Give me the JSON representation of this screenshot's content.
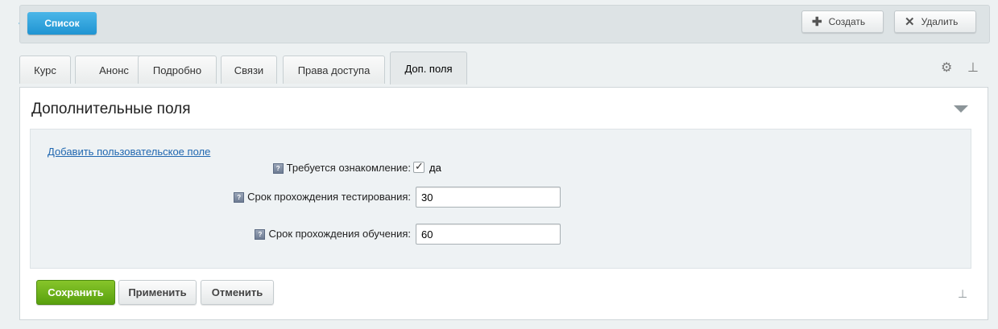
{
  "header": {
    "list_button": "Список",
    "create_button": "Создать",
    "delete_button": "Удалить"
  },
  "tabs": [
    {
      "label": "Курс"
    },
    {
      "label": "Анонс"
    },
    {
      "label": "Подробно"
    },
    {
      "label": "Связи"
    },
    {
      "label": "Права доступа"
    },
    {
      "label": "Доп. поля",
      "active": true
    }
  ],
  "panel": {
    "title": "Дополнительные поля",
    "add_field_link": "Добавить пользовательское поле",
    "fields": {
      "familiarization": {
        "label": "Требуется ознакомление:",
        "checked": true,
        "value_label": "да"
      },
      "test_period": {
        "label": "Срок прохождения тестирования:",
        "value": "30"
      },
      "study_period": {
        "label": "Срок прохождения обучения:",
        "value": "60"
      }
    },
    "help_glyph": "?"
  },
  "footer": {
    "save_button": "Сохранить",
    "apply_button": "Применить",
    "cancel_button": "Отменить"
  },
  "icons": {
    "settings": "gear-icon",
    "pin": "pin-icon",
    "collapse": "chevron-down-icon",
    "create": "plus-icon",
    "delete": "close-icon"
  },
  "colors": {
    "accent_blue": "#1f94d2",
    "save_green": "#58a00e",
    "link": "#2067b0"
  }
}
